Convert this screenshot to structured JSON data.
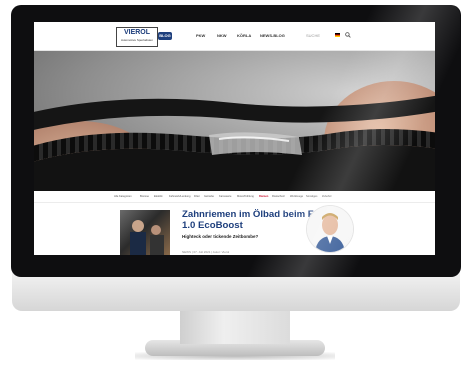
{
  "site": {
    "logo_text": "VIEROL",
    "logo_sub": "Automotive Spezialisten",
    "blog_label": "BLOG",
    "nav_items": [
      "PKW",
      "NKW",
      "KÖRLA",
      "NEWS-BLOG"
    ],
    "search_placeholder": "SUCHE",
    "flag": "de-flag-icon"
  },
  "categories": {
    "label": "Alle Kategorien",
    "items": [
      "Bremse",
      "Elektrik",
      "Fahrwerk/Lenkung",
      "Filter",
      "Getriebe",
      "Karosserie",
      "Motor/Kühlung",
      "Riemen",
      "Rostschutz",
      "Werkzeuge",
      "Sonstiges",
      "Zubehör"
    ]
  },
  "article": {
    "title": "Zahnriemen im Ölbad beim Ford 1.0 EcoBoost",
    "subtitle": "Highteck oder tickende Zeitbombe?",
    "meta": "NEWS | 07. Juli 2021 | Autor: Vierol"
  },
  "colors": {
    "brand": "#1e3f7d",
    "bezel": "#0e0e10"
  }
}
